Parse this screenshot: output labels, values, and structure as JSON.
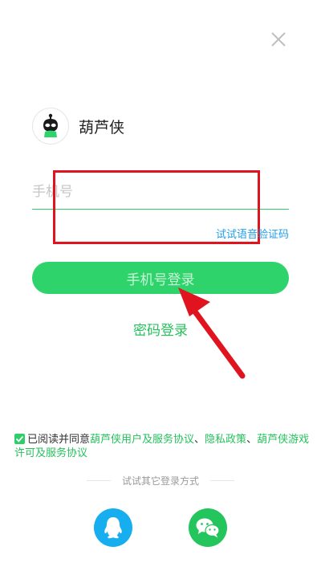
{
  "app": {
    "name": "葫芦侠"
  },
  "login": {
    "phone_placeholder": "手机号",
    "voice_code_link": "试试语音验证码",
    "login_button": "手机号登录",
    "password_login": "密码登录"
  },
  "agreement": {
    "checked": true,
    "prefix": "已阅读并同意",
    "link1": "葫芦侠用户及服务协议",
    "sep1": "、",
    "link2": "隐私政策",
    "sep2": "、",
    "link3": "葫芦侠游戏许可及服务协议"
  },
  "other_login": {
    "label": "试试其它登录方式"
  },
  "icons": {
    "close": "close-icon",
    "logo": "app-logo-icon",
    "qq": "qq-icon",
    "wechat": "wechat-icon",
    "check": "check-icon"
  },
  "colors": {
    "accent": "#2ed36c",
    "link_blue": "#1e9ee8",
    "highlight": "#e0141e",
    "qq": "#17aef0",
    "wechat": "#24c55c"
  }
}
